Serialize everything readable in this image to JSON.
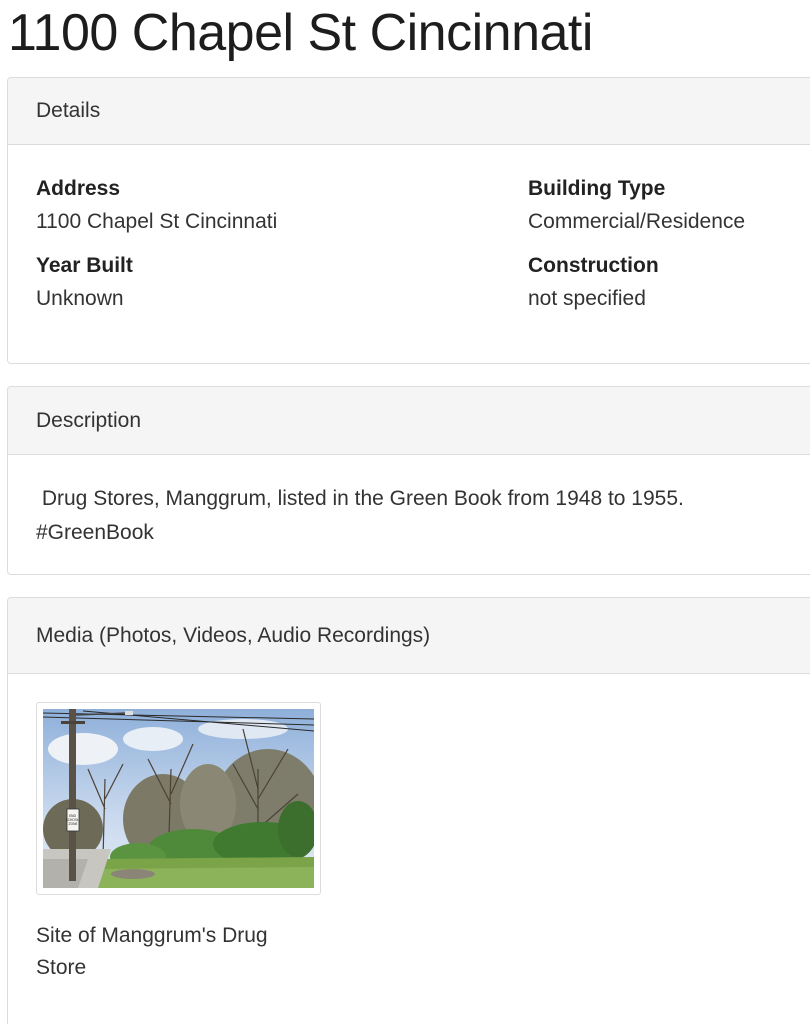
{
  "page": {
    "title": "1100 Chapel St Cincinnati"
  },
  "details": {
    "header": "Details",
    "address_label": "Address",
    "address_value": "1100 Chapel St Cincinnati",
    "building_type_label": "Building Type",
    "building_type_value": "Commercial/Residence",
    "year_built_label": "Year Built",
    "year_built_value": "Unknown",
    "construction_label": "Construction",
    "construction_value": "not specified"
  },
  "description": {
    "header": "Description",
    "text": " Drug Stores, Manggrum, listed in the Green Book from 1948 to 1955. #GreenBook"
  },
  "media": {
    "header": "Media (Photos, Videos, Audio Recordings)",
    "items": [
      {
        "caption": "Site of Manggrum's Drug Store",
        "sign_text": "END SCHOOL ZONE"
      }
    ]
  }
}
